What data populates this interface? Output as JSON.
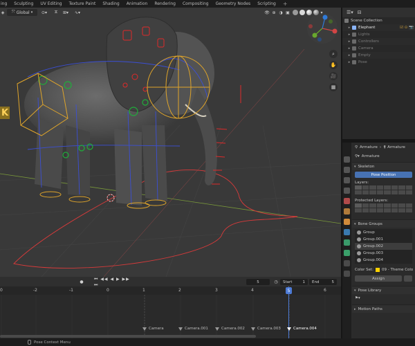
{
  "workspace_tabs": [
    "ing",
    "Sculpting",
    "UV Editing",
    "Texture Paint",
    "Shading",
    "Animation",
    "Rendering",
    "Compositing",
    "Geometry Nodes",
    "Scripting",
    "+"
  ],
  "viewport": {
    "orientation": "Global",
    "marker_letter": "K"
  },
  "outliner": {
    "scene_collection": "Scene Collection",
    "items": [
      {
        "label": "Elephant",
        "color": "#e6e6e6",
        "icon_color": "#8ab4f8"
      },
      {
        "label": "Lights",
        "color": "#7d7d7d",
        "icon_color": "#6a6a6a"
      },
      {
        "label": "Controllers",
        "color": "#7d7d7d",
        "icon_color": "#6a6a6a"
      },
      {
        "label": "Camera",
        "color": "#7d7d7d",
        "icon_color": "#6a6a6a"
      },
      {
        "label": "Empty",
        "color": "#7d7d7d",
        "icon_color": "#6a6a6a"
      },
      {
        "label": "Pose",
        "color": "#7d7d7d",
        "icon_color": "#6a6a6a"
      }
    ]
  },
  "properties": {
    "breadcrumb_a": "Armature",
    "breadcrumb_b": "Armature",
    "data_name": "Armature",
    "skeleton_title": "Skeleton",
    "pose_position": "Pose Position",
    "layers_label": "Layers:",
    "protected_layers_label": "Protected Layers:",
    "bone_groups_title": "Bone Groups",
    "bone_groups": [
      "Group",
      "Group.001",
      "Group.002",
      "Group.003",
      "Group.004"
    ],
    "selected_group_index": 2,
    "color_set_label": "Color Set:",
    "color_set_value": "09 - Theme Colo",
    "assign_label": "Assign",
    "pose_library_title": "Pose Library",
    "motion_paths_title": "Motion Paths"
  },
  "timeline": {
    "current_frame": "5",
    "start_label": "Start",
    "start_value": "1",
    "end_label": "End",
    "end_value": "5",
    "ticks": [
      "0",
      "-2",
      "-1",
      "0",
      "1",
      "2",
      "3",
      "4",
      "5",
      "6"
    ],
    "playhead_label": "5",
    "markers": [
      "Camera",
      "Camera.001",
      "Camera.002",
      "Camera.003",
      "Camera.004"
    ]
  },
  "status": {
    "context_menu": "Pose Context Menu"
  }
}
